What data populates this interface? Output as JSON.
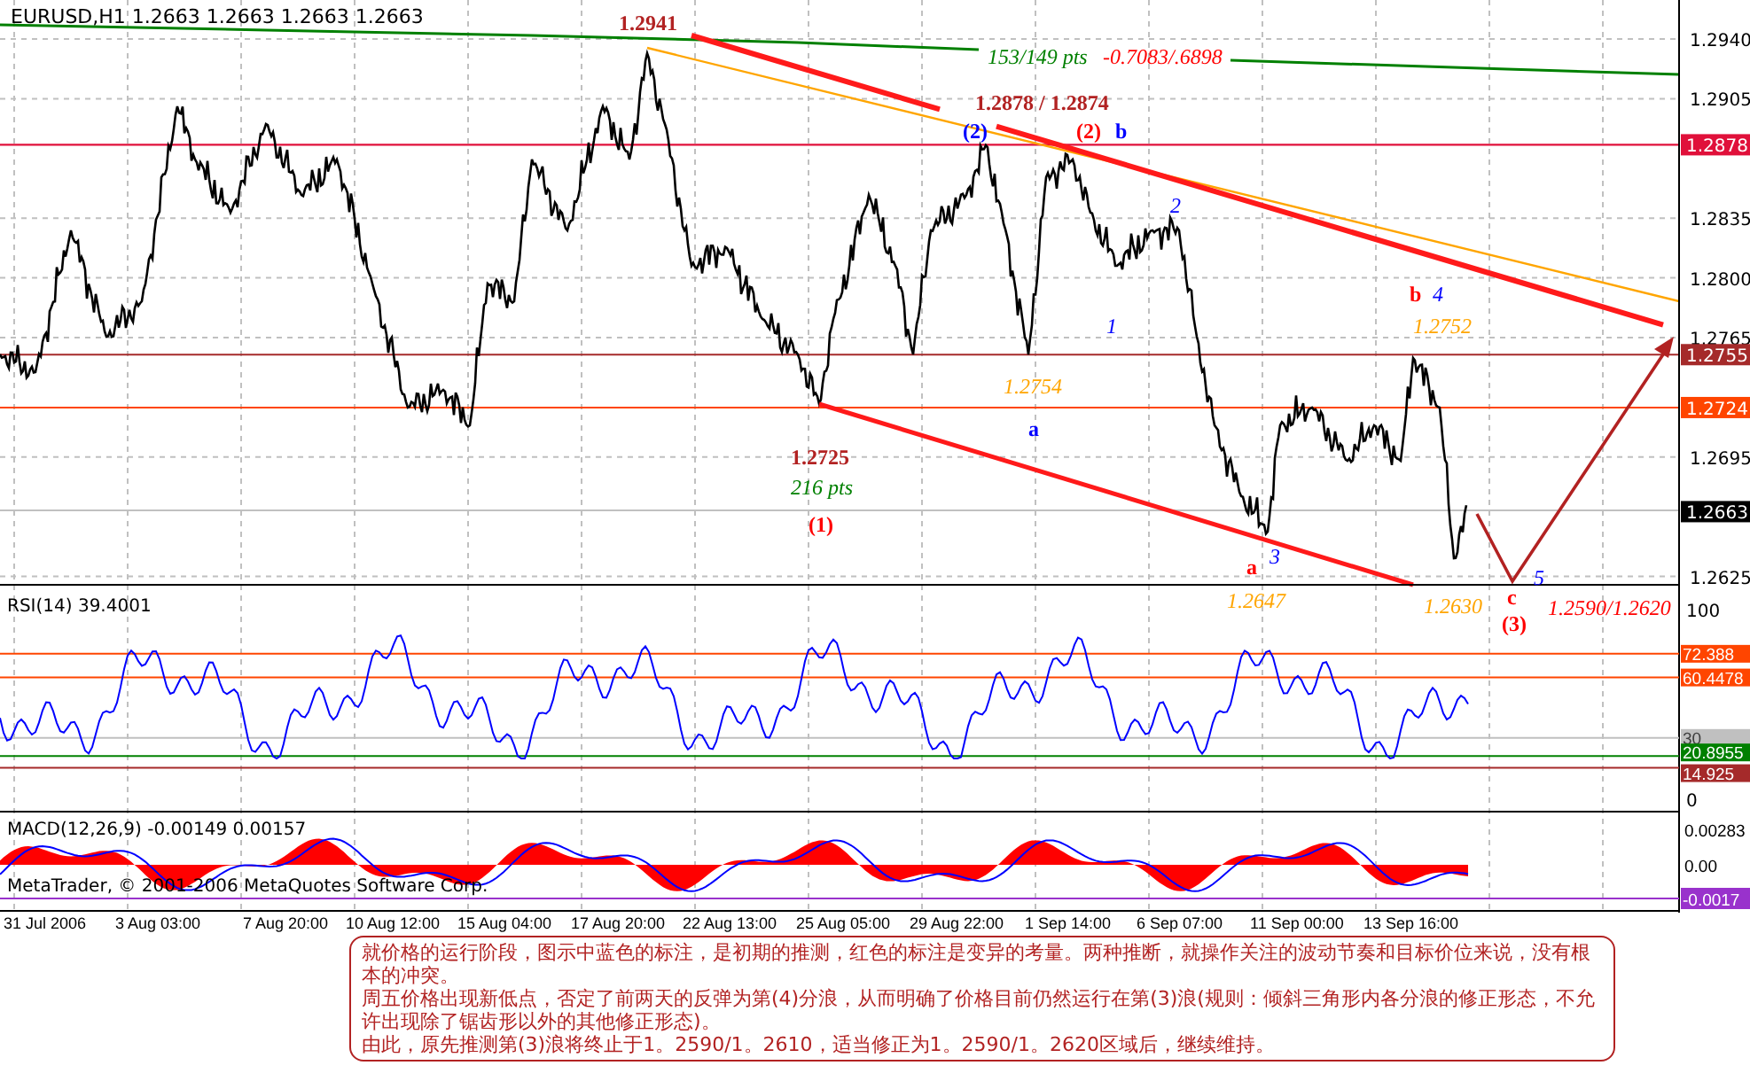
{
  "chart": {
    "title": "EURUSD,H1  1.2663 1.2663 1.2663 1.2663",
    "annotations": [
      {
        "text": "1.2941",
        "color": "#b22222",
        "kind": "label"
      },
      {
        "text": "153/149 pts",
        "color": "#008000",
        "kind": "note"
      },
      {
        "text": "-0.7083/.6898",
        "color": "#ff0000",
        "kind": "note"
      },
      {
        "text": "1.2878 / 1.2874",
        "color": "#b22222",
        "kind": "label"
      },
      {
        "text": "(2)",
        "color": "#0000ff",
        "kind": "label"
      },
      {
        "text": "(2)",
        "color": "#ff0000",
        "kind": "label"
      },
      {
        "text": "b",
        "color": "#0000ff",
        "kind": "label"
      },
      {
        "text": "2",
        "color": "#0000ff",
        "kind": "note"
      },
      {
        "text": "1",
        "color": "#0000ff",
        "kind": "note"
      },
      {
        "text": "b",
        "color": "#ff0000",
        "kind": "label"
      },
      {
        "text": "4",
        "color": "#0000ff",
        "kind": "note"
      },
      {
        "text": "1.2752",
        "color": "#ffa500",
        "kind": "note"
      },
      {
        "text": "1.2754",
        "color": "#ffa500",
        "kind": "note"
      },
      {
        "text": "a",
        "color": "#0000ff",
        "kind": "label"
      },
      {
        "text": "1.2725",
        "color": "#b22222",
        "kind": "label"
      },
      {
        "text": "216 pts",
        "color": "#008000",
        "kind": "note"
      },
      {
        "text": "(1)",
        "color": "#ff0000",
        "kind": "label"
      },
      {
        "text": "a",
        "color": "#ff0000",
        "kind": "label"
      },
      {
        "text": "3",
        "color": "#0000ff",
        "kind": "note"
      },
      {
        "text": "1.2647",
        "color": "#ffa500",
        "kind": "note"
      },
      {
        "text": "5",
        "color": "#0000ff",
        "kind": "note"
      },
      {
        "text": "1.2630",
        "color": "#ffa500",
        "kind": "note"
      },
      {
        "text": "c",
        "color": "#ff0000",
        "kind": "label"
      },
      {
        "text": "(3)",
        "color": "#ff0000",
        "kind": "label"
      },
      {
        "text": "1.2590/1.2620",
        "color": "#ff0000",
        "kind": "note"
      }
    ],
    "price_ticks": [
      "1.2940",
      "1.2905",
      "1.2835",
      "1.2800",
      "1.2765",
      "1.2695",
      "1.2625"
    ],
    "price_tags": [
      {
        "text": "1.2878",
        "color": "#e0103a"
      },
      {
        "text": "1.2755",
        "color": "#a52a2a"
      },
      {
        "text": "1.2724",
        "color": "#ff4500"
      },
      {
        "text": "1.2663",
        "color": "#000000"
      }
    ]
  },
  "rsi": {
    "title": "RSI(14) 39.4001",
    "ticks": [
      "100",
      "0"
    ],
    "tags": [
      {
        "text": "72.388",
        "color": "#ff4500"
      },
      {
        "text": "60.4478",
        "color": "#ff4500"
      },
      {
        "text": "30",
        "color": "#c0c0c0"
      },
      {
        "text": "20.8955",
        "color": "#008000"
      },
      {
        "text": "14.925",
        "color": "#a52a2a"
      }
    ]
  },
  "macd": {
    "title": "MACD(12,26,9) -0.00149 0.00157",
    "ticks": [
      "0.00283",
      "0.00"
    ],
    "tags": [
      {
        "text": "-0.0017",
        "color": "#9932cc"
      }
    ]
  },
  "copyright": "MetaTrader, © 2001-2006 MetaQuotes Software Corp.",
  "time_axis": [
    "31 Jul 2006",
    "3 Aug 03:00",
    "7 Aug 20:00",
    "10 Aug 12:00",
    "15 Aug 04:00",
    "17 Aug 20:00",
    "22 Aug 13:00",
    "25 Aug 05:00",
    "29 Aug 22:00",
    "1 Sep 14:00",
    "6 Sep 07:00",
    "11 Sep 00:00",
    "13 Sep 16:00"
  ],
  "comment": [
    "就价格的运行阶段，图示中蓝色的标注，是初期的推测，红色的标注是变异的考量。两种推断，就操作关注的波动节奏和目标价位来说，没有根本的冲突。",
    "周五价格出现新低点，否定了前两天的反弹为第(4)分浪，从而明确了价格目前仍然运行在第(3)浪(规则：倾斜三角形内各分浪的修正形态，不允许出现除了锯齿形以外的其他修正形态)。",
    "由此，原先推测第(3)浪将终止于1。2590/1。2610，适当修正为1。2590/1。2620区域后，继续维持。"
  ]
}
